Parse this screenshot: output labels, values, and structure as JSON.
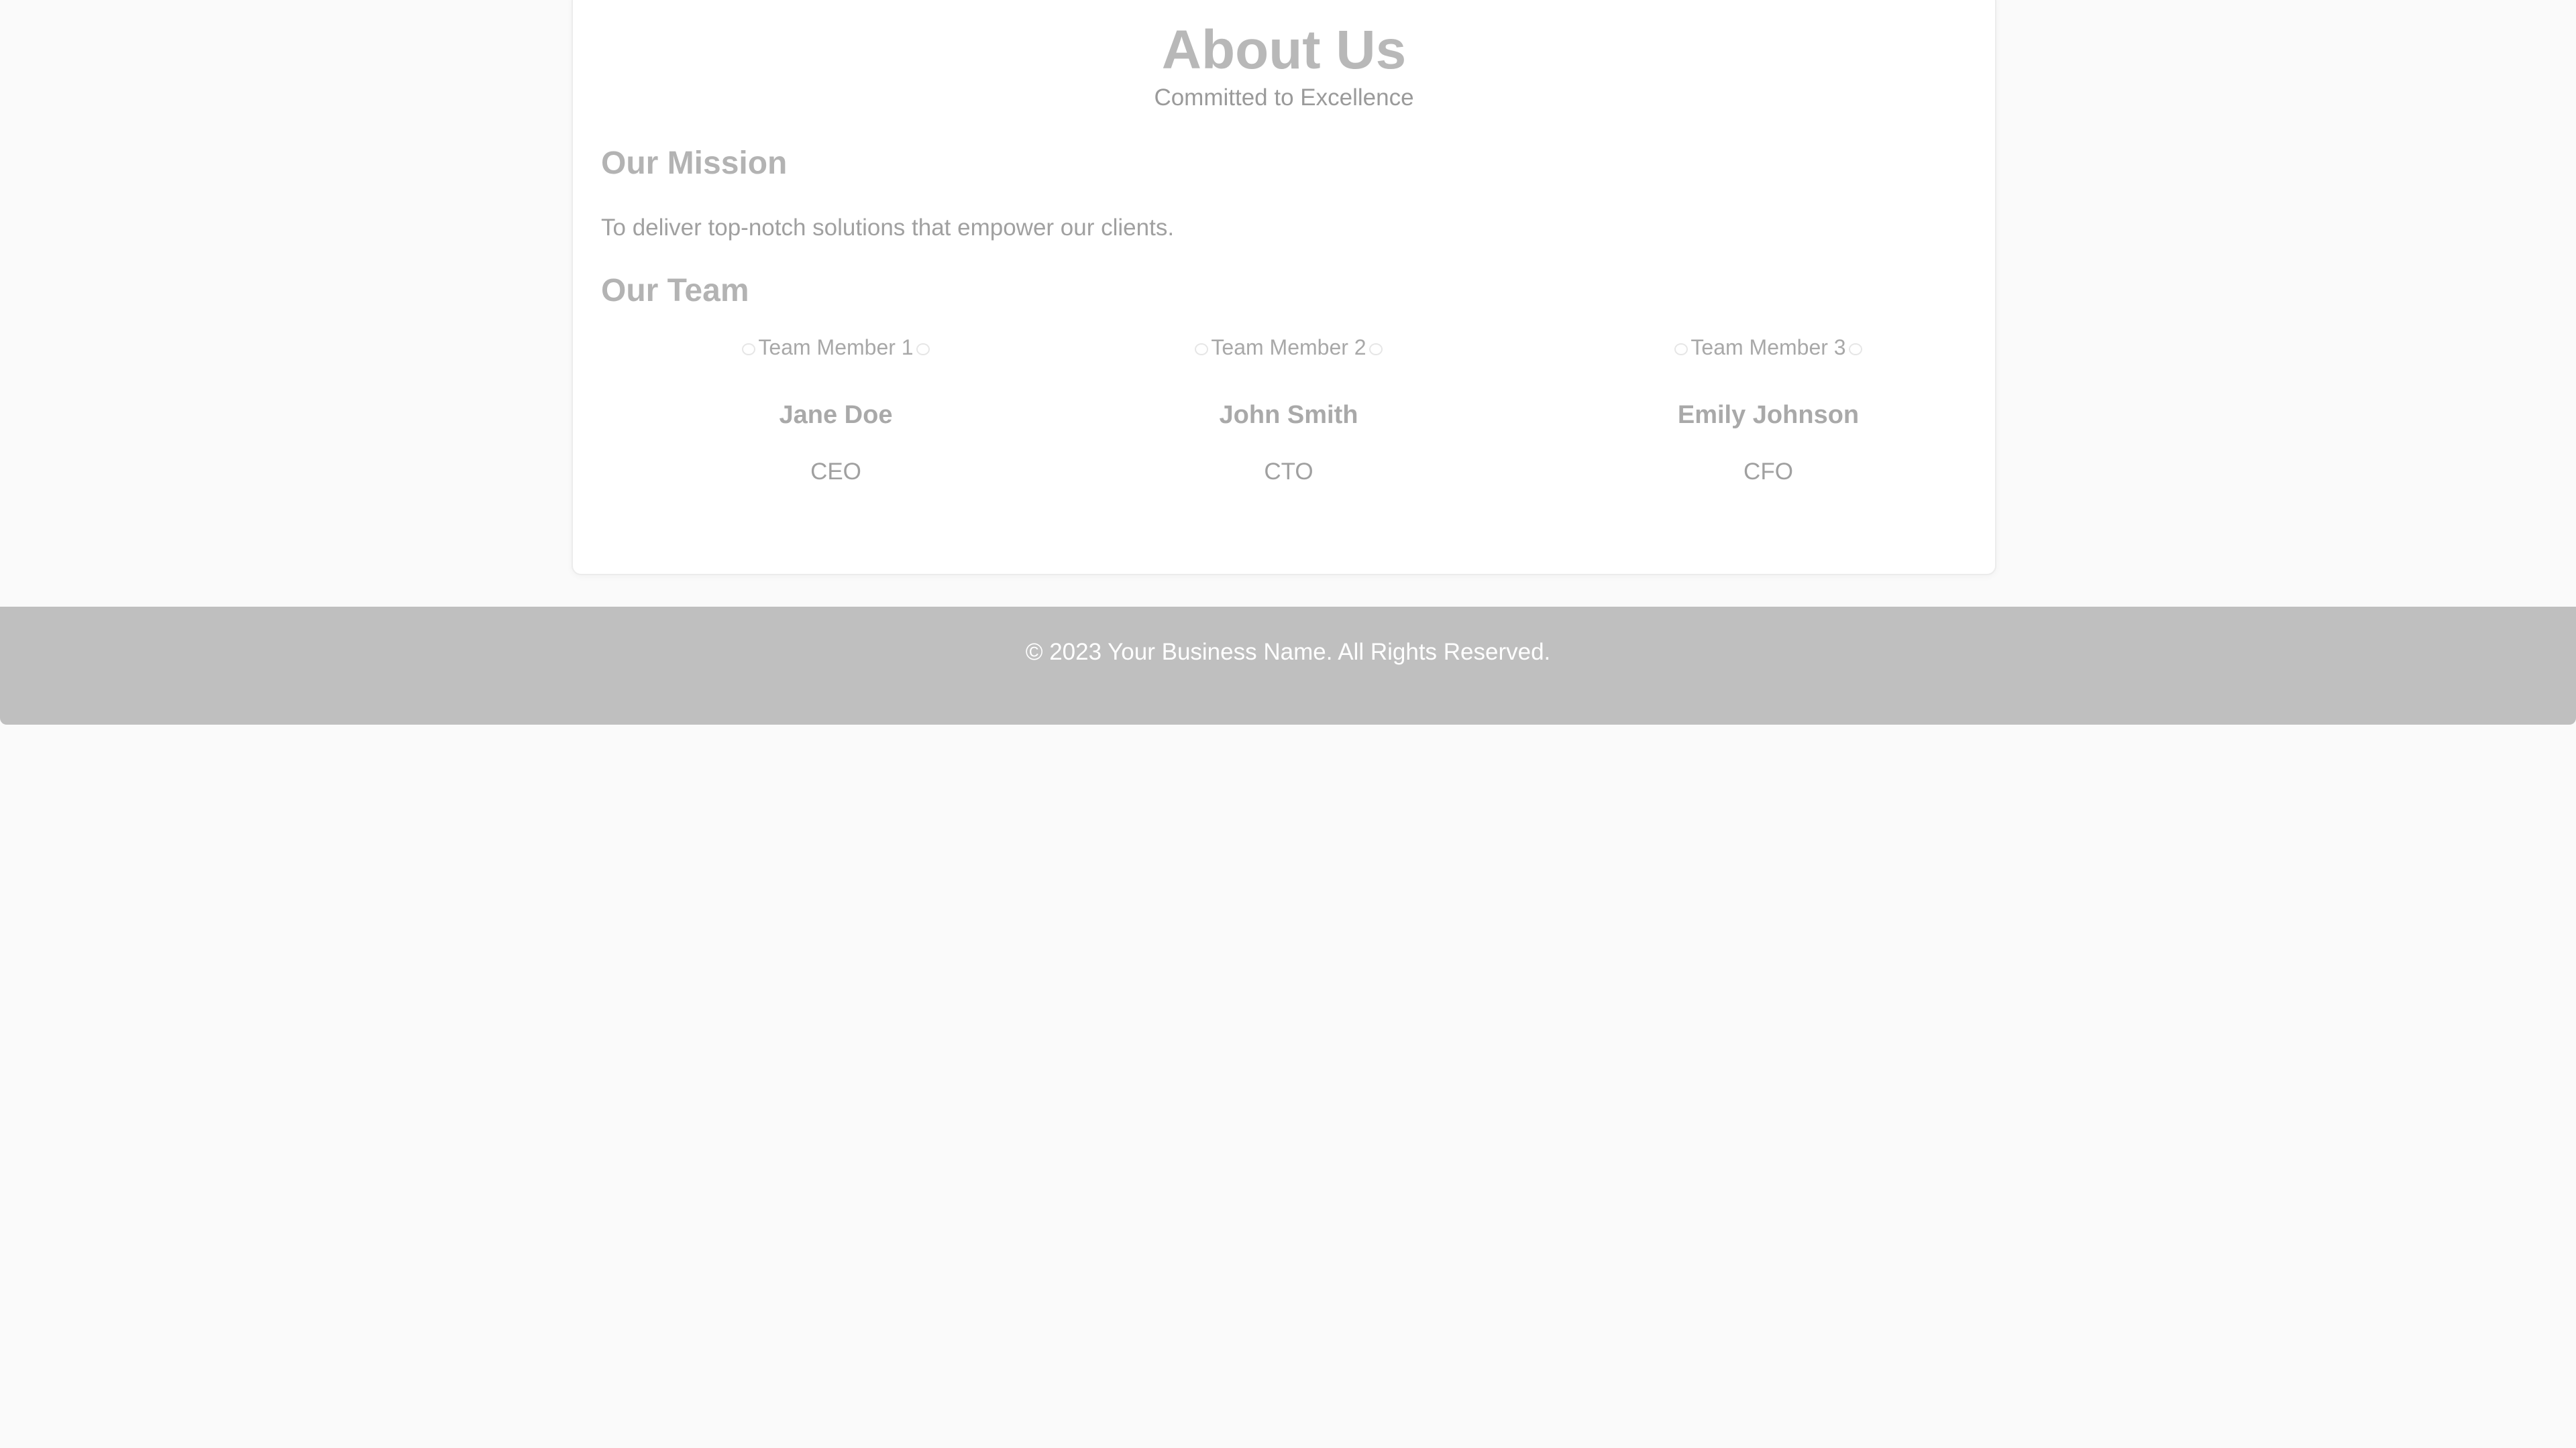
{
  "header": {
    "title": "About Us",
    "subtitle": "Committed to Excellence"
  },
  "mission": {
    "heading": "Our Mission",
    "text": "To deliver top-notch solutions that empower our clients."
  },
  "team": {
    "heading": "Our Team",
    "members": [
      {
        "photo_alt": "Team Member 1",
        "name": "Jane Doe",
        "role": "CEO"
      },
      {
        "photo_alt": "Team Member 2",
        "name": "John Smith",
        "role": "CTO"
      },
      {
        "photo_alt": "Team Member 3",
        "name": "Emily Johnson",
        "role": "CFO"
      }
    ]
  },
  "footer": {
    "text": "© 2023 Your Business Name. All Rights Reserved."
  },
  "colors": {
    "page_background": "#fafafa",
    "card_background": "#ffffff",
    "footer_background": "#bfbfbf",
    "footer_text": "#ffffff"
  }
}
